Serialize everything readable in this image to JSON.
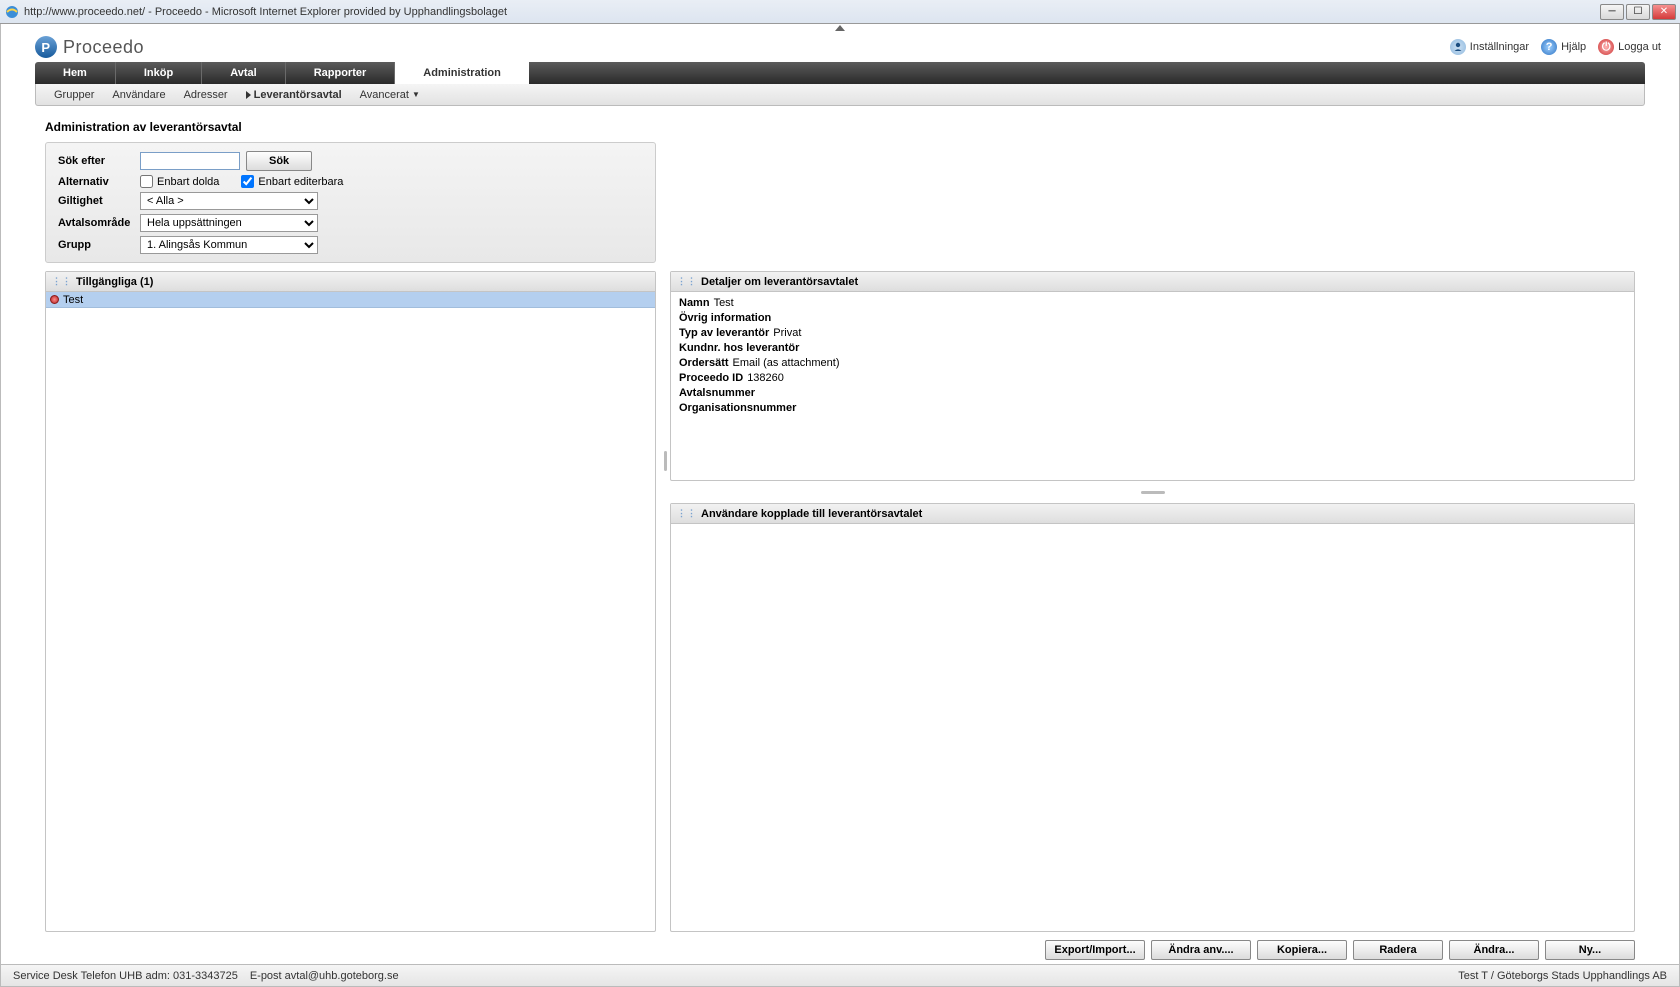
{
  "browser": {
    "title": "http://www.proceedo.net/ - Proceedo - Microsoft Internet Explorer provided by Upphandlingsbolaget"
  },
  "header": {
    "logo_text": "Proceedo",
    "links": {
      "settings": "Inställningar",
      "help": "Hjälp",
      "logout": "Logga ut"
    }
  },
  "main_tabs": [
    "Hem",
    "Inköp",
    "Avtal",
    "Rapporter",
    "Administration"
  ],
  "sub_nav": {
    "items": [
      "Grupper",
      "Användare",
      "Adresser",
      "Leverantörsavtal",
      "Avancerat"
    ],
    "active": "Leverantörsavtal"
  },
  "page_title": "Administration av leverantörsavtal",
  "filters": {
    "search_label": "Sök efter",
    "search_value": "",
    "search_button": "Sök",
    "alternatives_label": "Alternativ",
    "only_hidden": {
      "label": "Enbart dolda",
      "checked": false
    },
    "only_editable": {
      "label": "Enbart editerbara",
      "checked": true
    },
    "validity_label": "Giltighet",
    "validity_value": "< Alla >",
    "area_label": "Avtalsområde",
    "area_value": "Hela uppsättningen",
    "group_label": "Grupp",
    "group_value": "1. Alingsås Kommun"
  },
  "available": {
    "title": "Tillgängliga (1)",
    "rows": [
      {
        "name": "Test"
      }
    ]
  },
  "details": {
    "title": "Detaljer om leverantörsavtalet",
    "fields": {
      "name_k": "Namn",
      "name_v": "Test",
      "other_k": "Övrig information",
      "other_v": "",
      "type_k": "Typ av leverantör",
      "type_v": "Privat",
      "custno_k": "Kundnr. hos leverantör",
      "custno_v": "",
      "order_k": "Ordersätt",
      "order_v": "Email (as attachment)",
      "pid_k": "Proceedo ID",
      "pid_v": "138260",
      "agr_k": "Avtalsnummer",
      "agr_v": "",
      "org_k": "Organisationsnummer",
      "org_v": ""
    }
  },
  "linked_users": {
    "title": "Användare kopplade till leverantörsavtalet"
  },
  "actions": {
    "export": "Export/Import...",
    "change_users": "Ändra anv....",
    "copy": "Kopiera...",
    "delete": "Radera",
    "edit": "Ändra...",
    "new": "Ny..."
  },
  "status_bar": {
    "left1": "Service Desk Telefon UHB adm: 031-3343725",
    "left2": "E-post avtal@uhb.goteborg.se",
    "right": "Test T / Göteborgs Stads Upphandlings AB"
  }
}
